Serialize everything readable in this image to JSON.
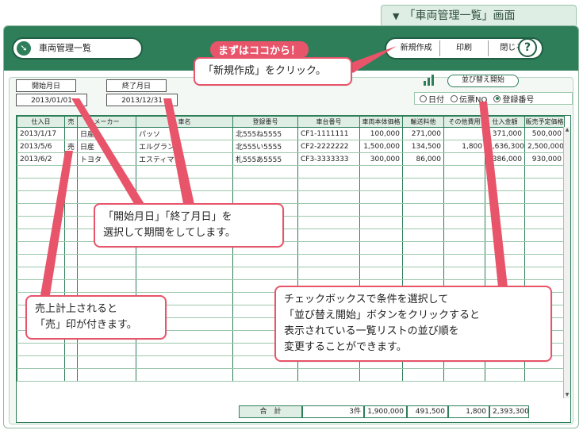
{
  "page_tag": "「車両管理一覧」画面",
  "window": {
    "title": "車両管理一覧",
    "buttons": [
      "新規作成",
      "印刷",
      "閉じる"
    ],
    "help": "?"
  },
  "dates": {
    "start_label": "開始月日",
    "start_value": "2013/01/01",
    "end_label": "終了月日",
    "end_value": "2013/12/31"
  },
  "sort": {
    "button": "並び替え開始",
    "options": [
      "日付",
      "伝票NO",
      "登録番号"
    ],
    "selected": "登録番号"
  },
  "table": {
    "columns": [
      "仕入日",
      "売",
      "メーカー",
      "車名",
      "登録番号",
      "車台番号",
      "車両本体価格",
      "輸送料他",
      "その他費用",
      "仕入金額",
      "販売予定価格"
    ],
    "rows": [
      [
        "2013/1/17",
        "",
        "日産",
        "パッソ",
        "北555ね5555",
        "CF1-1111111",
        "100,000",
        "271,000",
        "",
        "371,000",
        "500,000"
      ],
      [
        "2013/5/6",
        "売",
        "日産",
        "エルグラン",
        "北555い5555",
        "CF2-2222222",
        "1,500,000",
        "134,500",
        "1,800",
        "1,636,300",
        "2,500,000"
      ],
      [
        "2013/6/2",
        "",
        "トヨタ",
        "エスティマ",
        "札555あ5555",
        "CF3-3333333",
        "300,000",
        "86,000",
        "",
        "386,000",
        "930,000"
      ]
    ],
    "totals": {
      "label": "合　計",
      "count": "3件",
      "body": "1,900,000",
      "transport": "491,500",
      "other": "1,800",
      "purchase": "2,393,300"
    }
  },
  "callouts": {
    "start_here": "まずはココから！",
    "new": "「新規作成」をクリック。",
    "dates_line1": "「開始月日」「終了月日」を",
    "dates_line2": "選択して期間をしてします。",
    "sold_line1": "売上計上されると",
    "sold_line2": "「売」印が付きます。",
    "sort_line1": "チェックボックスで条件を選択して",
    "sort_line2": "「並び替え開始」ボタンをクリックすると",
    "sort_line3": "表示されている一覧リストの並び順を",
    "sort_line4": "変更することができます。"
  },
  "colors": {
    "accent": "#2e7e5a",
    "callout": "#e8546a"
  }
}
